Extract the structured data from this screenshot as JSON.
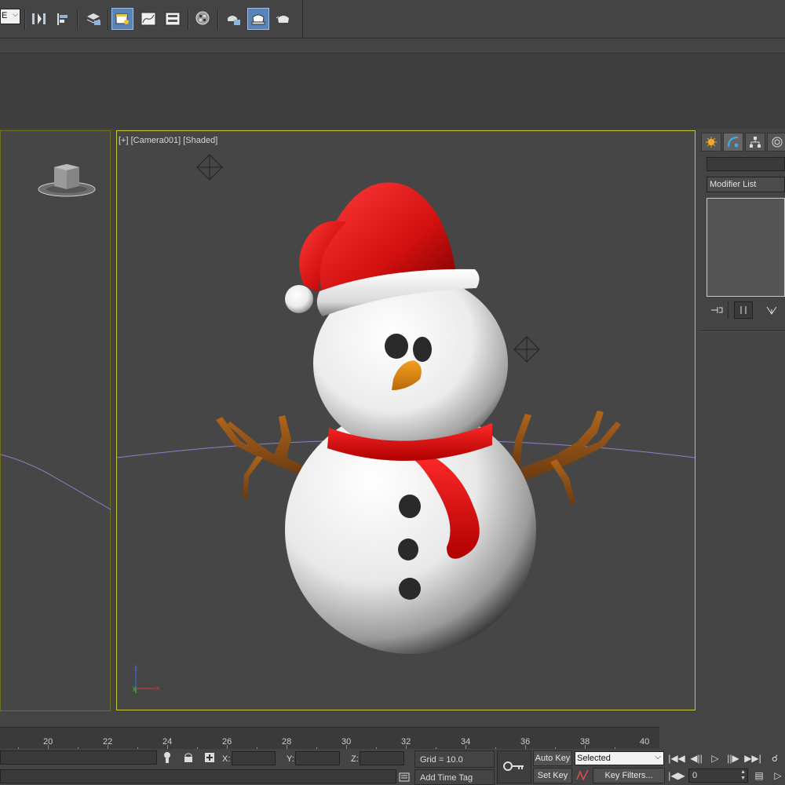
{
  "toolbar": {
    "dropdown_value": "E",
    "icons": [
      "mirror-icon",
      "align-icon",
      "layer-manager-icon",
      "scene-explorer-icon",
      "curve-editor-icon",
      "schematic-view-icon",
      "material-editor-icon",
      "render-setup-icon",
      "rendered-frame-icon",
      "render-production-icon",
      "render-iterative-icon"
    ],
    "accent": "#5a83b8"
  },
  "viewports": {
    "camera": {
      "label": "[+] [Camera001] [Shaded]",
      "border_color": "#c8c832"
    },
    "left": {
      "viewcube_icon": "viewcube-icon"
    }
  },
  "command_panel": {
    "tabs": [
      "create-tab",
      "modify-tab",
      "hierarchy-tab",
      "motion-tab"
    ],
    "name_value": "",
    "modifier_list_label": "Modifier List"
  },
  "timeline": {
    "ticks": [
      "20",
      "22",
      "24",
      "26",
      "28",
      "30",
      "32",
      "34",
      "36",
      "38",
      "40"
    ]
  },
  "status": {
    "x_label": "X:",
    "y_label": "Y:",
    "z_label": "Z:",
    "x_value": "",
    "y_value": "",
    "z_value": "",
    "grid_label": "Grid = 10.0",
    "add_time_tag": "Add Time Tag",
    "auto_key": "Auto Key",
    "set_key": "Set Key",
    "selected_option": "Selected",
    "key_filters": "Key Filters...",
    "frame_value": "0"
  }
}
